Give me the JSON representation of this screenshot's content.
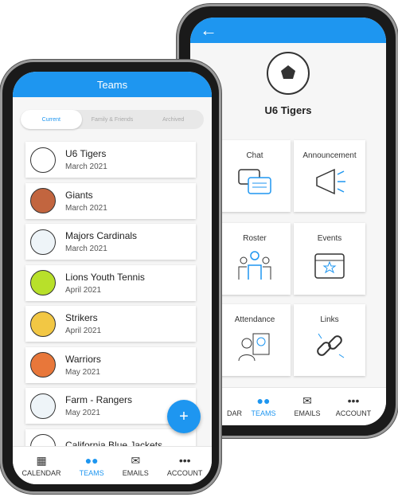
{
  "colors": {
    "accent": "#1e96f0"
  },
  "back": {
    "back_icon": "arrow-left-icon",
    "team_name": "U6 Tigers",
    "tiles": [
      {
        "label": "Chat",
        "icon": "chat-icon"
      },
      {
        "label": "Announcement",
        "icon": "megaphone-icon"
      },
      {
        "label": "Roster",
        "icon": "people-icon"
      },
      {
        "label": "Events",
        "icon": "calendar-icon"
      },
      {
        "label": "Attendance",
        "icon": "clipboard-icon"
      },
      {
        "label": "Links",
        "icon": "link-icon"
      }
    ],
    "nav": [
      {
        "label": "DAR"
      },
      {
        "label": "TEAMS"
      },
      {
        "label": "EMAILS"
      },
      {
        "label": "ACCOUNT"
      }
    ]
  },
  "front": {
    "title": "Teams",
    "tabs": [
      {
        "label": "Current"
      },
      {
        "label": "Family & Friends"
      },
      {
        "label": "Archived"
      }
    ],
    "teams": [
      {
        "name": "U6 Tigers",
        "date": "March 2021",
        "sport": "soccer",
        "color": "#ffffff"
      },
      {
        "name": "Giants",
        "date": "March 2021",
        "sport": "football",
        "color": "#c2653f"
      },
      {
        "name": "Majors Cardinals",
        "date": "March 2021",
        "sport": "baseball",
        "color": "#eef4f8"
      },
      {
        "name": "Lions Youth Tennis",
        "date": "April 2021",
        "sport": "tennis",
        "color": "#b8e02a"
      },
      {
        "name": "Strikers",
        "date": "April 2021",
        "sport": "volleyball",
        "color": "#f2c744"
      },
      {
        "name": "Warriors",
        "date": "May 2021",
        "sport": "basketball",
        "color": "#e8773a"
      },
      {
        "name": "Farm - Rangers",
        "date": "May 2021",
        "sport": "baseball",
        "color": "#eef4f8"
      },
      {
        "name": "California Blue Jackets",
        "date": "",
        "sport": "other",
        "color": "#ffffff"
      }
    ],
    "fab": "+",
    "nav": [
      {
        "label": "CALENDAR"
      },
      {
        "label": "TEAMS"
      },
      {
        "label": "EMAILS"
      },
      {
        "label": "ACCOUNT"
      }
    ]
  }
}
